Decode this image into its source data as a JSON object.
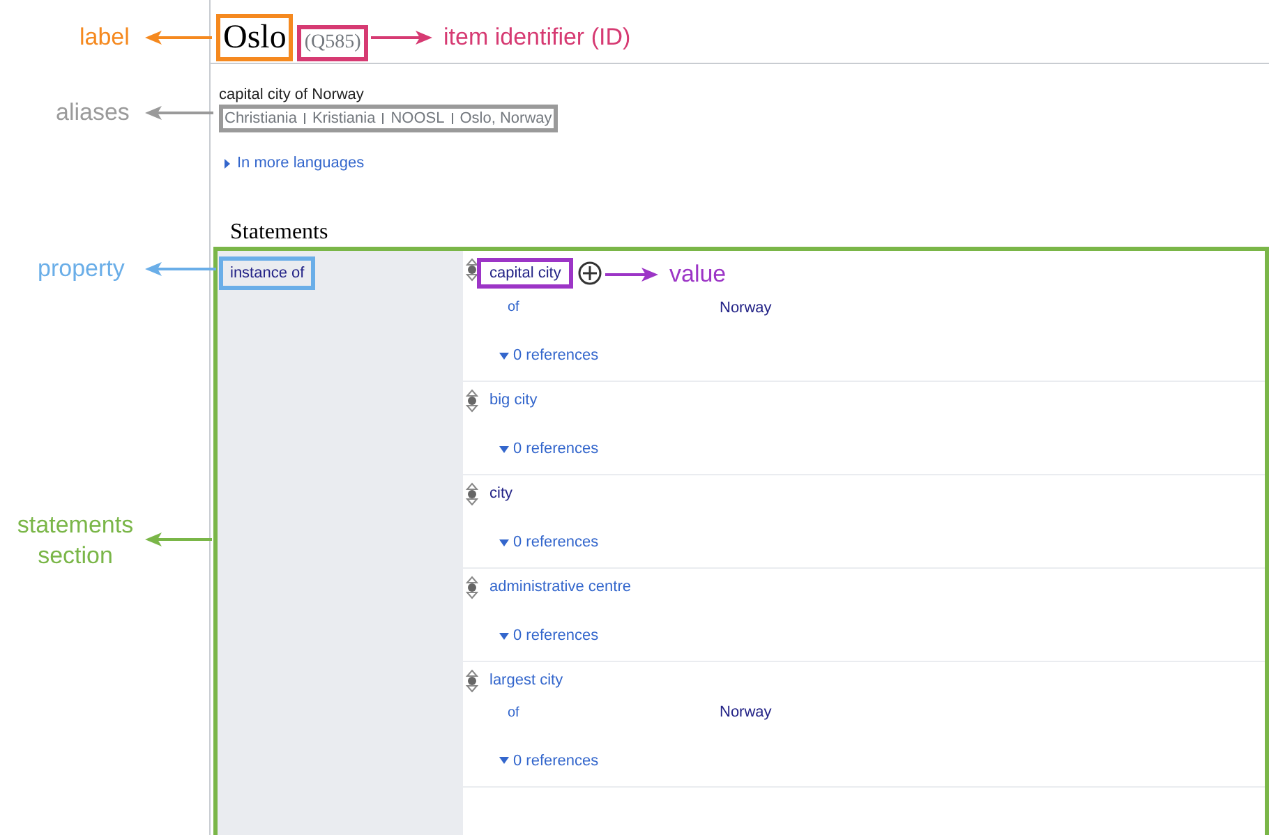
{
  "header": {
    "label": "Oslo",
    "id": "(Q585)"
  },
  "description": "capital city of Norway",
  "aliases": [
    "Christiania",
    "Kristiania",
    "NOOSL",
    "Oslo, Norway"
  ],
  "more_languages": "In more languages",
  "statements": {
    "heading": "Statements",
    "property": "instance of",
    "values": [
      {
        "value": "capital city",
        "visited": true,
        "highlighted": true,
        "qualifiers": [
          {
            "property": "of",
            "value": "Norway"
          }
        ],
        "references": "0 references"
      },
      {
        "value": "big city",
        "visited": false,
        "highlighted": false,
        "references": "0 references"
      },
      {
        "value": "city",
        "visited": true,
        "highlighted": false,
        "references": "0 references"
      },
      {
        "value": "administrative centre",
        "visited": false,
        "highlighted": false,
        "references": "0 references"
      },
      {
        "value": "largest city",
        "visited": false,
        "highlighted": false,
        "qualifiers": [
          {
            "property": "of",
            "value": "Norway"
          }
        ],
        "references": "0 references"
      }
    ]
  },
  "annotations": [
    {
      "kind": "label",
      "text": "label",
      "color": "#f5891f"
    },
    {
      "kind": "id",
      "text": "item identifier (ID)",
      "color": "#d63a72"
    },
    {
      "kind": "aliases",
      "text": "aliases",
      "color": "#9a9a9a"
    },
    {
      "kind": "property",
      "text": "property",
      "color": "#6aaee8"
    },
    {
      "kind": "value",
      "text": "value",
      "color": "#9c35c6"
    },
    {
      "kind": "section",
      "text": "statements section",
      "color": "#7ab648"
    }
  ]
}
